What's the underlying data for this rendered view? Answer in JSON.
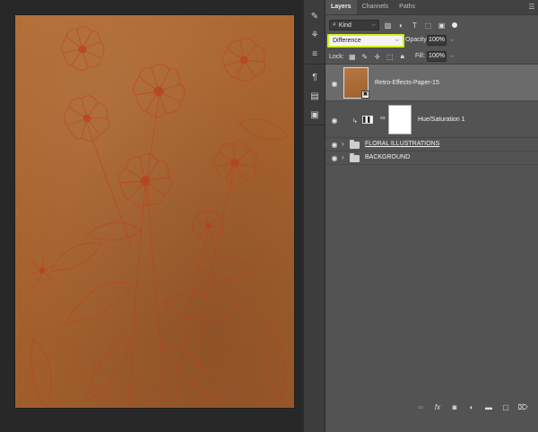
{
  "canvas": {
    "document_name": "Retro-Effects-Paper-15 (floral illustration)"
  },
  "toolstrip": {
    "icons": [
      "history-brush-icon",
      "brush-preset-icon",
      "adjustments-icon",
      "paragraph-icon",
      "character-icon",
      "notes-icon"
    ]
  },
  "layers_panel": {
    "tabs": [
      {
        "label": "Layers",
        "active": true
      },
      {
        "label": "Channels",
        "active": false
      },
      {
        "label": "Paths",
        "active": false
      }
    ],
    "filter": {
      "kind_label": "Kind"
    },
    "blend_mode": "Difference",
    "opacity_label": "Opacity:",
    "opacity_value": "100%",
    "lock_label": "Lock:",
    "fill_label": "Fill:",
    "fill_value": "100%",
    "layers": [
      {
        "name": "Retro-Effects-Paper-15",
        "type": "smart-object",
        "selected": true,
        "visible": true
      },
      {
        "name": "Hue/Saturation 1",
        "type": "adjustment",
        "selected": false,
        "visible": true,
        "clipped": true
      },
      {
        "name": "FLORAL ILLUSTRATIONS",
        "type": "group",
        "selected": false,
        "visible": true,
        "expanded": false
      },
      {
        "name": "BACKGROUND",
        "type": "group",
        "selected": false,
        "visible": true,
        "expanded": false
      }
    ],
    "bottom_icons": [
      "link-layers-icon",
      "fx-icon",
      "add-mask-icon",
      "adjustment-layer-icon",
      "new-group-icon",
      "new-layer-icon",
      "delete-layer-icon"
    ]
  },
  "colors": {
    "highlight_outline": "#d6f020",
    "paper_tone": "#a6622e"
  }
}
